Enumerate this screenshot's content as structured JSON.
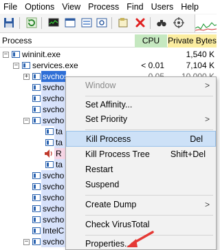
{
  "menu": [
    "File",
    "Options",
    "View",
    "Process",
    "Find",
    "Users",
    "Help"
  ],
  "columns": {
    "process": "Process",
    "cpu": "CPU",
    "private_bytes": "Private Bytes"
  },
  "rows": [
    {
      "name": "wininit.exe",
      "cpu": "",
      "private_bytes": "1,540 K"
    },
    {
      "name": "services.exe",
      "cpu": "< 0.01",
      "private_bytes": "7,104 K"
    },
    {
      "name": "svchost.exe",
      "cpu": "0.05",
      "private_bytes": "10,000 K"
    },
    {
      "name": "svcho",
      "cpu": "",
      "private_bytes": ""
    },
    {
      "name": "svcho",
      "cpu": "",
      "private_bytes": ""
    },
    {
      "name": "svcho",
      "cpu": "",
      "private_bytes": ""
    },
    {
      "name": "svcho",
      "cpu": "",
      "private_bytes": ""
    },
    {
      "name": "ta",
      "cpu": "",
      "private_bytes": ""
    },
    {
      "name": "ta",
      "cpu": "",
      "private_bytes": ""
    },
    {
      "name": "R",
      "cpu": "",
      "private_bytes": ""
    },
    {
      "name": "ta",
      "cpu": "",
      "private_bytes": ""
    },
    {
      "name": "svcho",
      "cpu": "",
      "private_bytes": ""
    },
    {
      "name": "svcho",
      "cpu": "",
      "private_bytes": ""
    },
    {
      "name": "svcho",
      "cpu": "",
      "private_bytes": ""
    },
    {
      "name": "svcho",
      "cpu": "",
      "private_bytes": ""
    },
    {
      "name": "svcho",
      "cpu": "",
      "private_bytes": ""
    },
    {
      "name": "IntelC",
      "cpu": "",
      "private_bytes": ""
    },
    {
      "name": "svcho",
      "cpu": "",
      "private_bytes": ""
    }
  ],
  "context_menu": {
    "window": "Window",
    "set_affinity": "Set Affinity...",
    "set_priority": "Set Priority",
    "kill_process": "Kill Process",
    "kill_process_shortcut": "Del",
    "kill_process_tree": "Kill Process Tree",
    "kill_process_tree_shortcut": "Shift+Del",
    "restart": "Restart",
    "suspend": "Suspend",
    "create_dump": "Create Dump",
    "check_virustotal": "Check VirusTotal",
    "properties": "Properties...",
    "submenu_arrow": ">"
  },
  "colors": {
    "selection": "#2f6fd6",
    "services_highlight": "#d7e2fb",
    "cpu_header": "#c5e8c0",
    "private_bytes_header": "#fbeda0",
    "annotation_arrow": "#e53935"
  }
}
